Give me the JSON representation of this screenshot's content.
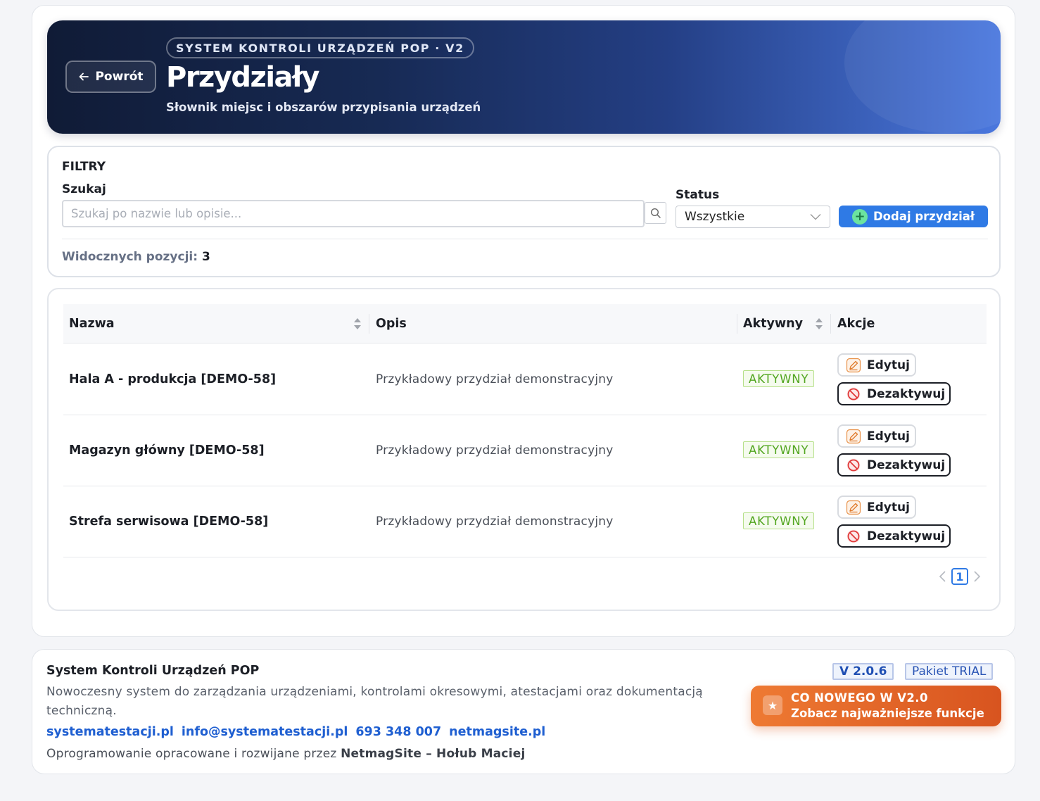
{
  "header": {
    "back_label": "Powrót",
    "eyebrow": "SYSTEM KONTROLI URZĄDZEŃ POP · V2",
    "title": "Przydziały",
    "subtitle": "Słownik miejsc i obszarów przypisania urządzeń"
  },
  "filters": {
    "title": "FILTRY",
    "search_label": "Szukaj",
    "search_placeholder": "Szukaj po nazwie lub opisie...",
    "search_value": "",
    "status_label": "Status",
    "status_selected": "Wszystkie",
    "add_button": "Dodaj przydział",
    "visible_label": "Widocznych pozycji:",
    "visible_count": "3"
  },
  "table": {
    "columns": [
      "Nazwa",
      "Opis",
      "Aktywny",
      "Akcje"
    ],
    "rows": [
      {
        "name": "Hala A - produkcja [DEMO-58]",
        "description": "Przykładowy przydział demonstracyjny",
        "status": "AKTYWNY",
        "edit": "Edytuj",
        "deactivate": "Dezaktywuj"
      },
      {
        "name": "Magazyn główny [DEMO-58]",
        "description": "Przykładowy przydział demonstracyjny",
        "status": "AKTYWNY",
        "edit": "Edytuj",
        "deactivate": "Dezaktywuj"
      },
      {
        "name": "Strefa serwisowa [DEMO-58]",
        "description": "Przykładowy przydział demonstracyjny",
        "status": "AKTYWNY",
        "edit": "Edytuj",
        "deactivate": "Dezaktywuj"
      }
    ],
    "pagination": {
      "current_page": "1"
    }
  },
  "footer": {
    "title": "System Kontroli Urządzeń POP",
    "description": "Nowoczesny system do zarządzania urządzeniami, kontrolami okresowymi, atestacjami oraz dokumentacją techniczną.",
    "links": [
      "systematestacji.pl",
      "info@systematestacji.pl",
      "693 348 007",
      "netmagsite.pl"
    ],
    "credit_prefix": "Oprogramowanie opracowane i rozwijane przez",
    "credit_author": "NetmagSite – Hołub Maciej",
    "version": "V 2.0.6",
    "plan": "Pakiet TRIAL",
    "whats_new_title": "CO NOWEGO W V2.0",
    "whats_new_sub": "Zobacz najważniejsze funkcje"
  },
  "colors": {
    "accent": "#2f7ae5",
    "active_badge": "#52a620",
    "whats_new": "#e36a2a"
  },
  "icons": [
    "arrow-left-icon",
    "search-icon",
    "chevron-down-icon",
    "plus-icon",
    "sort-icon",
    "edit-icon",
    "ban-icon",
    "chevron-left-icon",
    "chevron-right-icon",
    "star-icon"
  ]
}
